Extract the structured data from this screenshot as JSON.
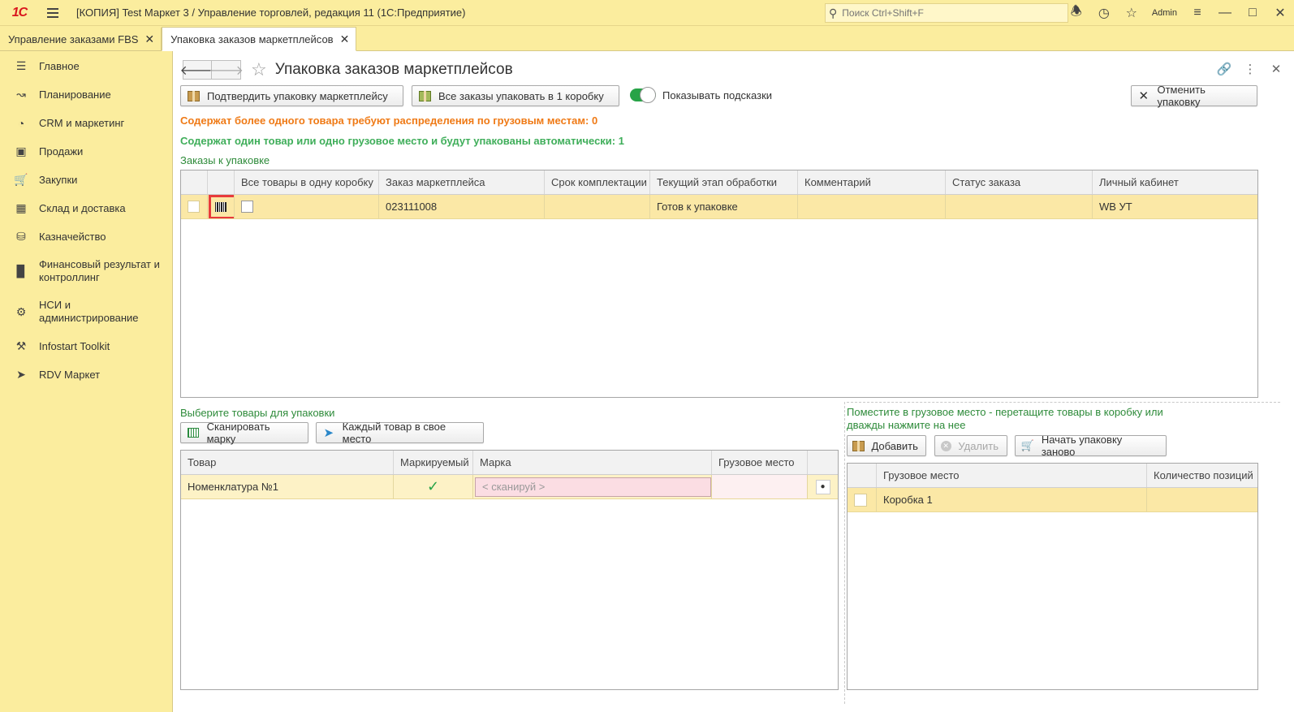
{
  "window": {
    "title": "[КОПИЯ] Test Маркет 3 / Управление торговлей, редакция 11  (1С:Предприятие)",
    "search_placeholder": "Поиск Ctrl+Shift+F",
    "user": "Admin",
    "logo_text": "1С"
  },
  "tabs": [
    {
      "label": "Управление заказами FBS",
      "active": false
    },
    {
      "label": "Упаковка заказов маркетплейсов",
      "active": true
    }
  ],
  "sidebar": {
    "items": [
      {
        "label": "Главное",
        "icon": "menu-lines-icon"
      },
      {
        "label": "Планирование",
        "icon": "planning-chart-icon"
      },
      {
        "label": "CRM и маркетинг",
        "icon": "pie-chart-icon"
      },
      {
        "label": "Продажи",
        "icon": "shopping-bag-icon"
      },
      {
        "label": "Закупки",
        "icon": "cart-icon"
      },
      {
        "label": "Склад и доставка",
        "icon": "warehouse-grid-icon"
      },
      {
        "label": "Казначейство",
        "icon": "coins-icon"
      },
      {
        "label": "Финансовый результат и контроллинг",
        "icon": "bar-chart-icon"
      },
      {
        "label": "НСИ и администрирование",
        "icon": "gear-icon"
      },
      {
        "label": "Infostart Toolkit",
        "icon": "tools-icon"
      },
      {
        "label": "RDV Маркет",
        "icon": "rocket-icon"
      }
    ]
  },
  "main": {
    "title": "Упаковка заказов маркетплейсов",
    "toolbar": {
      "confirm_label": "Подтвердить упаковку маркетплейсу",
      "pack_all_label": "Все заказы упаковать в 1 коробку",
      "hints_label": "Показывать подсказки",
      "hints_on": true,
      "cancel_label": "Отменить упаковку"
    },
    "info_multi": "Содержат более одного товара требуют распределения по грузовым местам: 0",
    "info_single": "Содержат один товар или одно грузовое место и будут упакованы автоматически: 1",
    "orders_label": "Заказы к упаковке",
    "orders_table": {
      "headers": [
        "",
        "",
        "Все товары в одну коробку",
        "Заказ маркетплейса",
        "Срок комплектации",
        "Текущий этап обработки",
        "Комментарий",
        "Статус заказа",
        "Личный кабинет"
      ],
      "rows": [
        {
          "order": "023111008",
          "deadline": "",
          "stage": "Готов к упаковке",
          "comment": "",
          "status": "",
          "cabinet": "WB УТ"
        }
      ]
    },
    "goods_label": "Выберите товары для упаковки",
    "goods_toolbar": {
      "scan_label": "Сканировать марку",
      "each_label": "Каждый товар в свое место"
    },
    "goods_table": {
      "headers": [
        "Товар",
        "Маркируемый",
        "Марка",
        "Грузовое место"
      ],
      "rows": [
        {
          "item": "Номенклатура №1",
          "marked": true,
          "mark_placeholder": "< сканируй >",
          "place": ""
        }
      ]
    },
    "places_label": "Поместите в грузовое место - перетащите товары в коробку или дважды нажмите на нее",
    "places_toolbar": {
      "add_label": "Добавить",
      "delete_label": "Удалить",
      "restart_label": "Начать упаковку заново"
    },
    "places_table": {
      "headers": [
        "",
        "Грузовое место",
        "Количество позиций"
      ],
      "rows": [
        {
          "place": "Коробка 1",
          "count": ""
        }
      ]
    }
  },
  "colors": {
    "panel_yellow": "#fbed9e",
    "row_selected": "#fbe8a6",
    "warning_orange": "#ef7a16",
    "ok_green": "#3fae5a",
    "section_green": "#2e8b3a",
    "toggle_green": "#27a347",
    "highlight_red": "#e83b3b"
  }
}
